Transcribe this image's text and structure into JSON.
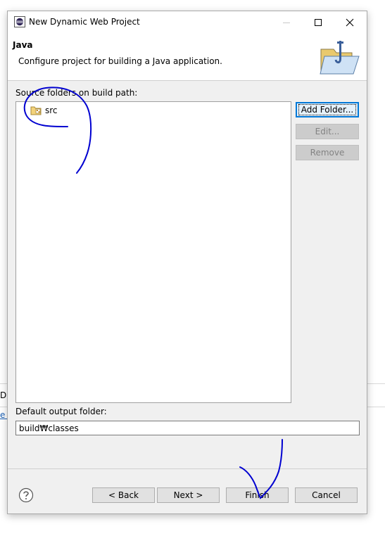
{
  "background": {
    "tab_fragment": "Da",
    "link_fragment": "e n"
  },
  "window": {
    "title": "New Dynamic Web Project",
    "minimize_icon": "minimize-icon",
    "maximize_icon": "maximize-icon",
    "close_icon": "close-icon"
  },
  "banner": {
    "title": "Java",
    "description": "Configure project for building a Java application.",
    "icon": "java-folder-wizard-icon"
  },
  "source_folders": {
    "label": "Source folders on build path:",
    "items": [
      {
        "name": "src",
        "icon": "package-folder-icon"
      }
    ]
  },
  "side_buttons": {
    "add_folder": "Add Folder...",
    "edit": "Edit...",
    "remove": "Remove"
  },
  "output": {
    "label": "Default output folder:",
    "value": "build₩classes"
  },
  "footer": {
    "help_icon": "help-icon",
    "back": "< Back",
    "next": "Next >",
    "finish": "Finish",
    "cancel": "Cancel"
  },
  "colors": {
    "dialog_bg": "#f0f0f0",
    "default_button_border": "#0078d7",
    "annotation_ink": "#0000d0"
  }
}
